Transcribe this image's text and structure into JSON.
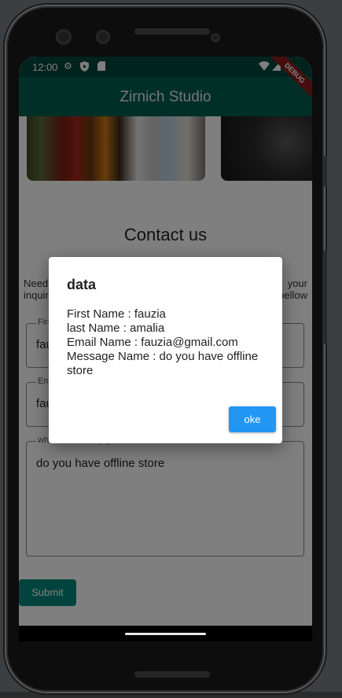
{
  "statusbar": {
    "time": "12:00",
    "icons": [
      "gear-icon",
      "shield-icon",
      "sd-card-icon",
      "wifi-icon",
      "signal-icon",
      "battery-icon"
    ],
    "debug_banner": "DEBUG"
  },
  "appbar": {
    "title": "Zirnich Studio",
    "color": "#005e4e"
  },
  "page": {
    "title": "Contact us",
    "intro_left_line1": "Need",
    "intro_left_line2": "inquir",
    "intro_right_line1": "your",
    "intro_right_line2": "bellow"
  },
  "form": {
    "first_name": {
      "label": "First",
      "value": "fau"
    },
    "email": {
      "label": "Em",
      "value": "fau"
    },
    "message": {
      "label": "what can we help you with",
      "value": "do you have offline store"
    },
    "submit_label": "Submit"
  },
  "dialog": {
    "title": "data",
    "lines": [
      "First Name : fauzia",
      "last Name : amalia",
      "Email Name : fauzia@gmail.com",
      "Message Name : do you have offline store"
    ],
    "ok_label": "oke",
    "ok_color": "#2196f3"
  }
}
